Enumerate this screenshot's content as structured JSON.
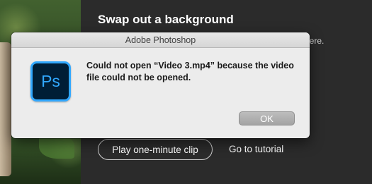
{
  "background_panel": {
    "title": "Swap out a background",
    "description_tail": "here.",
    "play_button_label": "Play one-minute clip",
    "tutorial_link_label": "Go to tutorial"
  },
  "dialog": {
    "title": "Adobe Photoshop",
    "icon_text": "Ps",
    "message": "Could not open “Video 3.mp4” because the video file could not be opened.",
    "ok_label": "OK"
  }
}
